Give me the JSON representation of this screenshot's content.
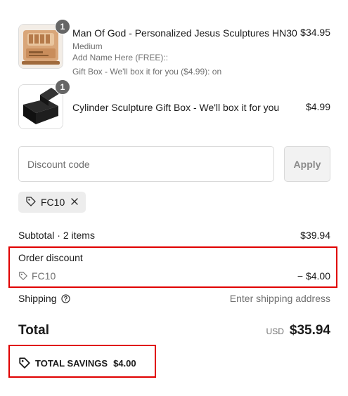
{
  "items": [
    {
      "quantity": "1",
      "title": "Man Of God - Personalized Jesus Sculptures HN30",
      "details": [
        "Medium",
        "Add Name Here (FREE)::",
        "Gift Box - We'll box it for you ($4.99): on"
      ],
      "price": "$34.95",
      "image_icon": "sculpture-thumbnail"
    },
    {
      "quantity": "1",
      "title": "Cylinder Sculpture Gift Box - We'll box it for you",
      "details": [],
      "price": "$4.99",
      "image_icon": "gift-box-thumbnail"
    }
  ],
  "discount": {
    "placeholder": "Discount code",
    "apply_label": "Apply",
    "applied_code": "FC10"
  },
  "summary": {
    "subtotal_label": "Subtotal · 2 items",
    "subtotal_value": "$39.94",
    "order_discount_label": "Order discount",
    "order_discount_code": "FC10",
    "order_discount_value": "− $4.00",
    "shipping_label": "Shipping",
    "shipping_value": "Enter shipping address",
    "total_label": "Total",
    "total_currency": "USD",
    "total_value": "$35.94",
    "savings_label": "TOTAL SAVINGS",
    "savings_value": "$4.00"
  },
  "colors": {
    "highlight": "#e00000",
    "badge": "#666666"
  }
}
